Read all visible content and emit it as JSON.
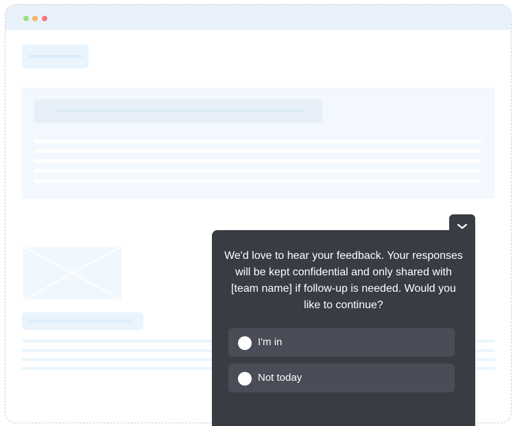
{
  "window": {
    "controls": [
      {
        "name": "green-dot",
        "color": "#9be07a"
      },
      {
        "name": "yellow-dot",
        "color": "#f5b76b"
      },
      {
        "name": "red-dot",
        "color": "#f37a7a"
      }
    ]
  },
  "survey": {
    "collapse_icon": "chevron-down-icon",
    "question": "We'd love to hear your feedback. Your responses will be kept confidential and only shared with [team name] if follow-up is needed. Would you like to continue?",
    "options": [
      {
        "label": "I'm in",
        "selected": false
      },
      {
        "label": "Not today",
        "selected": false
      }
    ],
    "colors": {
      "panel": "#3a3c44",
      "option": "#4a4c57",
      "text": "#ffffff"
    }
  }
}
